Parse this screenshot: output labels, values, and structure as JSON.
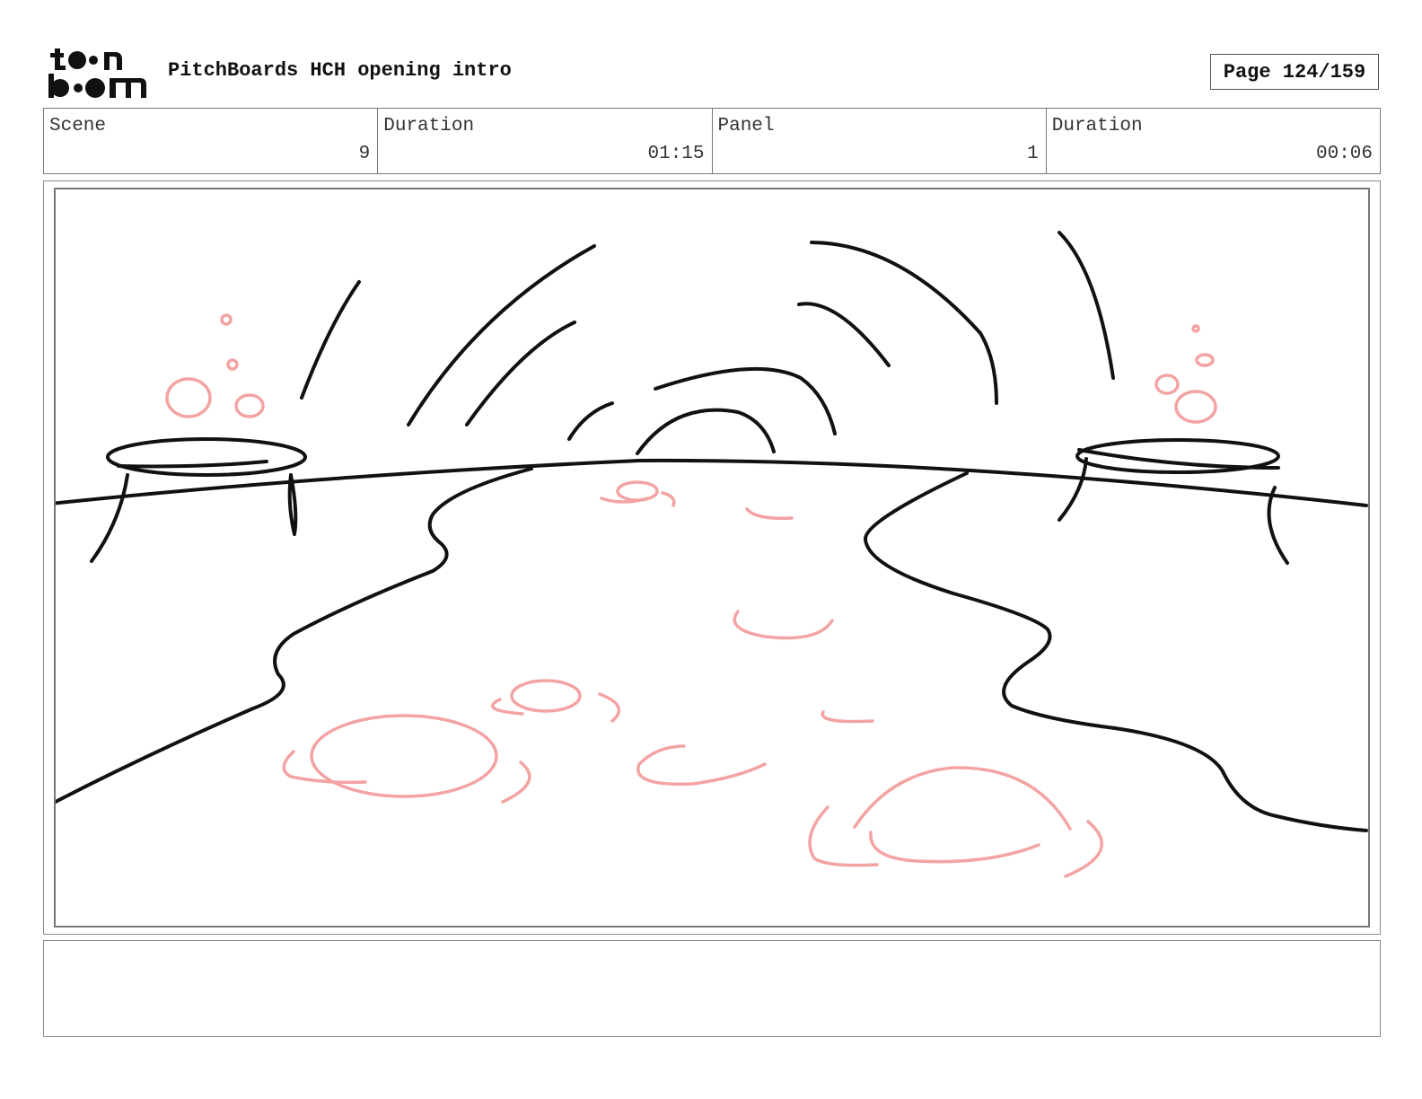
{
  "header": {
    "logo_text": "toon boom",
    "project_title": "PitchBoards HCH opening intro",
    "page_label": "Page 124/159"
  },
  "info": {
    "scene_label": "Scene",
    "scene_value": "9",
    "scene_duration_label": "Duration",
    "scene_duration_value": "01:15",
    "panel_label": "Panel",
    "panel_value": "1",
    "panel_duration_label": "Duration",
    "panel_duration_value": "00:06"
  },
  "sketch": {
    "line_color": "#111111",
    "highlight_color": "#f4a3a3"
  },
  "notes": {
    "text": ""
  }
}
